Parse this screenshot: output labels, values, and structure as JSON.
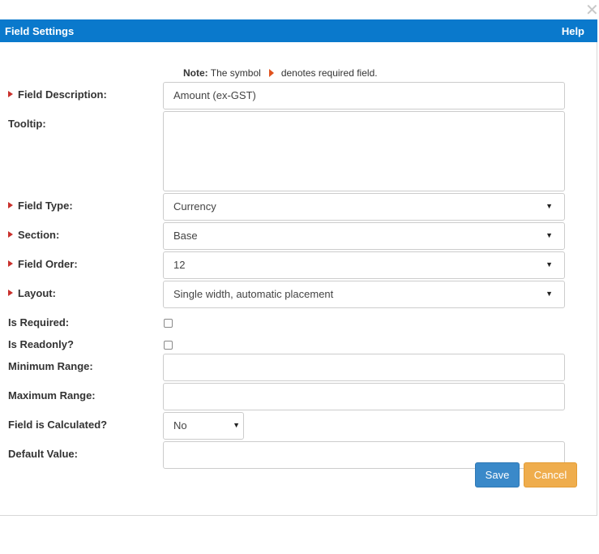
{
  "dialog": {
    "title": "Field Settings",
    "help_label": "Help",
    "close_glyph": "✕"
  },
  "note": {
    "prefix": "Note:",
    "text_before": "The symbol",
    "text_after": "denotes required field."
  },
  "form": {
    "field_description": {
      "label": "Field Description:",
      "required": true,
      "value": "Amount (ex-GST)"
    },
    "tooltip": {
      "label": "Tooltip:",
      "required": false,
      "value": ""
    },
    "field_type": {
      "label": "Field Type:",
      "required": true,
      "value": "Currency"
    },
    "section": {
      "label": "Section:",
      "required": true,
      "value": "Base"
    },
    "field_order": {
      "label": "Field Order:",
      "required": true,
      "value": "12"
    },
    "layout": {
      "label": "Layout:",
      "required": true,
      "value": "Single width, automatic placement"
    },
    "is_required": {
      "label": "Is Required:",
      "checked": false
    },
    "is_readonly": {
      "label": "Is Readonly?",
      "checked": false
    },
    "minimum_range": {
      "label": "Minimum Range:",
      "value": ""
    },
    "maximum_range": {
      "label": "Maximum Range:",
      "value": ""
    },
    "field_is_calculated": {
      "label": "Field is Calculated?",
      "value": "No"
    },
    "default_value": {
      "label": "Default Value:",
      "value": ""
    }
  },
  "buttons": {
    "save": "Save",
    "cancel": "Cancel"
  },
  "colors": {
    "titlebar": "#0a79cc",
    "required_marker": "#c9302c",
    "note_marker": "#e0521e",
    "save_button": "#3a89c9",
    "cancel_button": "#efad4d"
  },
  "icons": {
    "close": "close-icon",
    "required": "required-marker-icon",
    "dropdown": "chevron-down-icon"
  }
}
